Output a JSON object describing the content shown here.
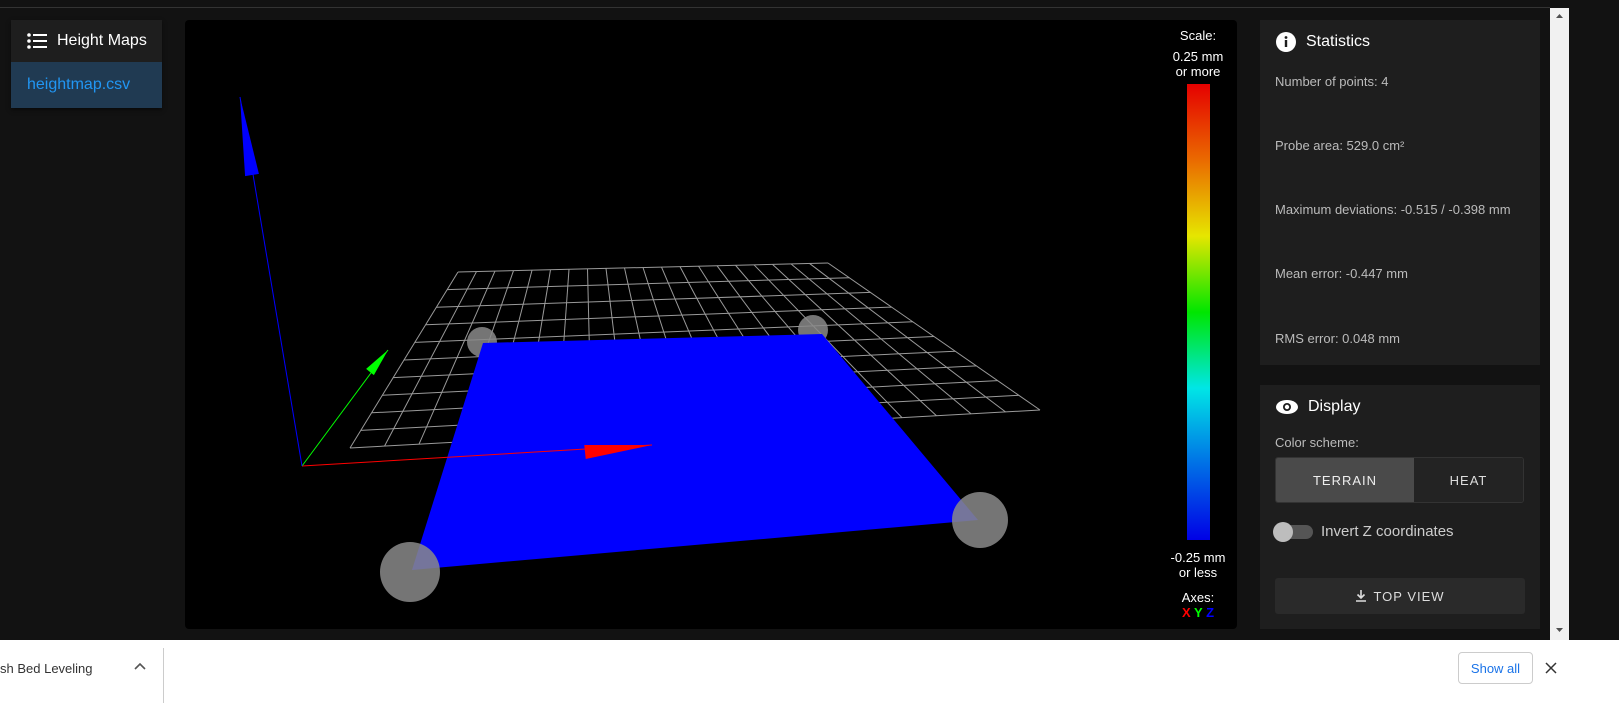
{
  "sidebar": {
    "title": "Height Maps",
    "icon": "list-icon",
    "items": [
      {
        "label": "heightmap.csv",
        "active": true
      }
    ]
  },
  "viewer": {
    "scale_title": "Scale:",
    "scale_max": "0.25 mm",
    "scale_max_sub": "or more",
    "scale_min": "-0.25 mm",
    "scale_min_sub": "or less",
    "axes_title": "Axes:",
    "axes": [
      {
        "label": "X",
        "color": "#ff0000"
      },
      {
        "label": "Y",
        "color": "#00ff00"
      },
      {
        "label": "Z",
        "color": "#0000ff"
      }
    ],
    "surface_color": "#0000ff"
  },
  "statistics": {
    "title": "Statistics",
    "icon": "info-icon",
    "points": "Number of points: 4",
    "area": "Probe area: 529.0 cm²",
    "deviations": "Maximum deviations: -0.515 / -0.398 mm",
    "mean": "Mean error: -0.447 mm",
    "rms": "RMS error: 0.048 mm"
  },
  "display": {
    "title": "Display",
    "icon": "eye-icon",
    "color_scheme_label": "Color scheme:",
    "schemes": [
      "TERRAIN",
      "HEAT"
    ],
    "selected": "TERRAIN",
    "invert_label": "Invert Z coordinates",
    "invert": false,
    "top_view": "TOP VIEW"
  },
  "download_bar": {
    "file": "sh Bed Leveling",
    "show_all": "Show all"
  }
}
